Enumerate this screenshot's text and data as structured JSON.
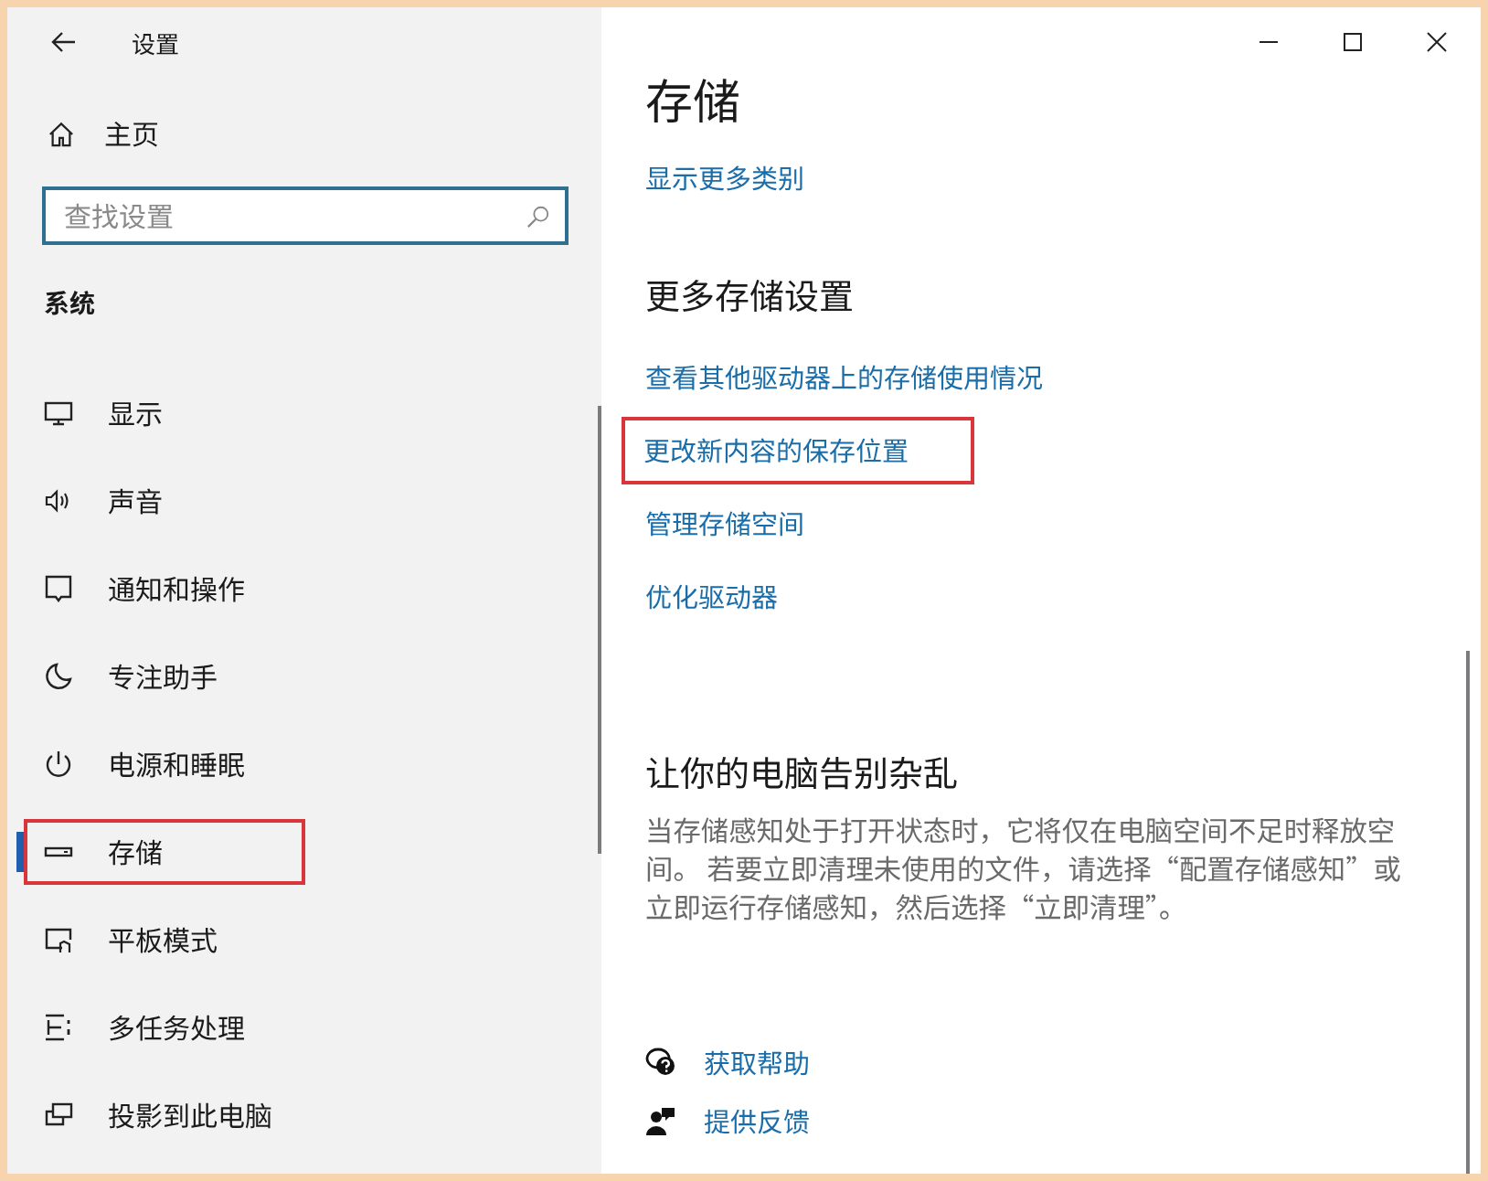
{
  "window": {
    "title": "设置"
  },
  "sidebar": {
    "home": "主页",
    "search": {
      "placeholder": "查找设置"
    },
    "section": "系统",
    "items": [
      {
        "label": "显示",
        "selected": false,
        "highlighted": false
      },
      {
        "label": "声音",
        "selected": false,
        "highlighted": false
      },
      {
        "label": "通知和操作",
        "selected": false,
        "highlighted": false
      },
      {
        "label": "专注助手",
        "selected": false,
        "highlighted": false
      },
      {
        "label": "电源和睡眠",
        "selected": false,
        "highlighted": false
      },
      {
        "label": "存储",
        "selected": true,
        "highlighted": true
      },
      {
        "label": "平板模式",
        "selected": false,
        "highlighted": false
      },
      {
        "label": "多任务处理",
        "selected": false,
        "highlighted": false
      },
      {
        "label": "投影到此电脑",
        "selected": false,
        "highlighted": false
      }
    ]
  },
  "content": {
    "title": "存储",
    "top_link": "显示更多类别",
    "more_settings": {
      "heading": "更多存储设置",
      "links": [
        {
          "label": "查看其他驱动器上的存储使用情况",
          "highlighted": false
        },
        {
          "label": "更改新内容的保存位置",
          "highlighted": true
        },
        {
          "label": "管理存储空间",
          "highlighted": false
        },
        {
          "label": "优化驱动器",
          "highlighted": false
        }
      ]
    },
    "declutter": {
      "heading": "让你的电脑告别杂乱",
      "paragraph": "当存储感知处于打开状态时，它将仅在电脑空间不足时释放空间。 若要立即清理未使用的文件，请选择“配置存储感知”或立即运行存储感知，然后选择“立即清理”。"
    },
    "help_links": [
      {
        "label": "获取帮助"
      },
      {
        "label": "提供反馈"
      }
    ]
  }
}
